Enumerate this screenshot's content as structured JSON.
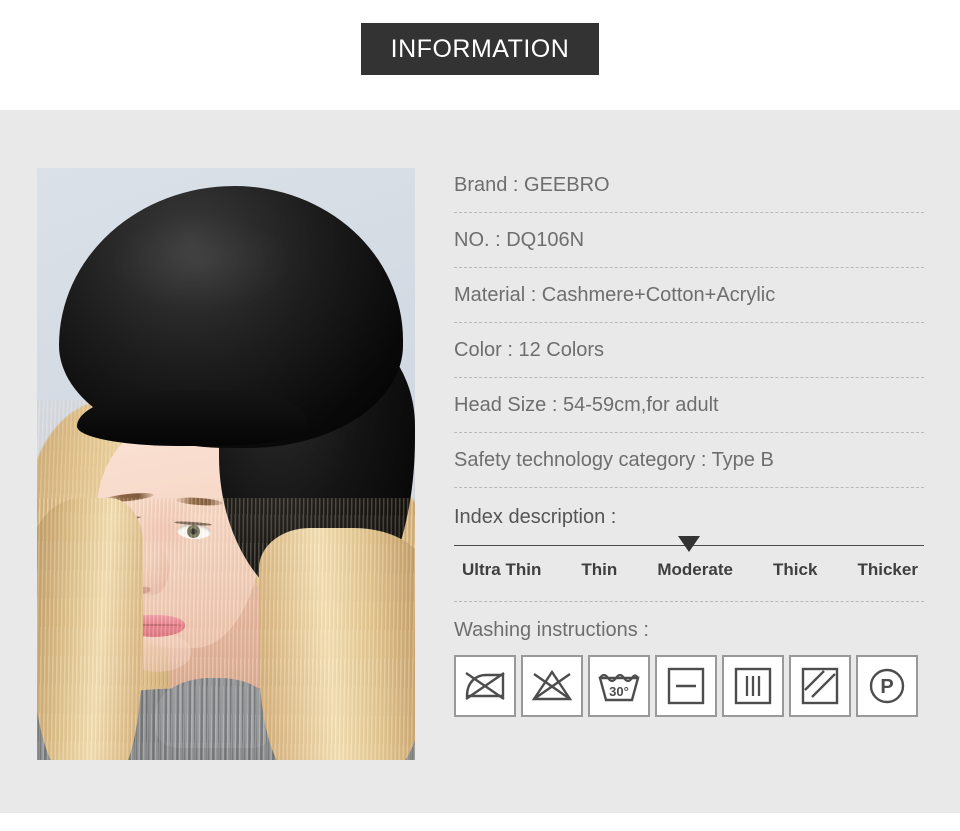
{
  "header": {
    "badge_label": "INFORMATION",
    "badge_bg": "#333333",
    "badge_text_color": "#ffffff"
  },
  "panel": {
    "background": "#e9e9e9"
  },
  "product_image": {
    "alt": "Model wearing black wool beret",
    "background_color": "#d6dce4",
    "hat_color": "#000000"
  },
  "specs": [
    {
      "label": "Brand : GEEBRO"
    },
    {
      "label": "NO. : DQ106N"
    },
    {
      "label": "Material : Cashmere+Cotton+Acrylic"
    },
    {
      "label": "Color : 12 Colors"
    },
    {
      "label": "Head Size : 54-59cm,for adult"
    },
    {
      "label": "Safety technology category : Type B"
    }
  ],
  "index": {
    "title": "Index description :",
    "levels": [
      "Ultra Thin",
      "Thin",
      "Moderate",
      "Thick",
      "Thicker"
    ],
    "selected": "Moderate",
    "marker_position_percent": 50,
    "marker_color": "#333333"
  },
  "washing": {
    "title": "Washing instructions :",
    "icons": [
      {
        "name": "do-not-wring-icon",
        "label": "Do not wring"
      },
      {
        "name": "do-not-bleach-icon",
        "label": "Do not bleach"
      },
      {
        "name": "machine-wash-30-icon",
        "label": "Machine wash 30°"
      },
      {
        "name": "dry-flat-icon",
        "label": "Dry flat"
      },
      {
        "name": "drip-dry-icon",
        "label": "Drip dry"
      },
      {
        "name": "dry-in-shade-icon",
        "label": "Dry in shade"
      },
      {
        "name": "professional-dry-clean-p-icon",
        "label": "Professional dry clean P"
      }
    ],
    "wash_temperature": "30°",
    "dry_clean_letter": "P"
  }
}
